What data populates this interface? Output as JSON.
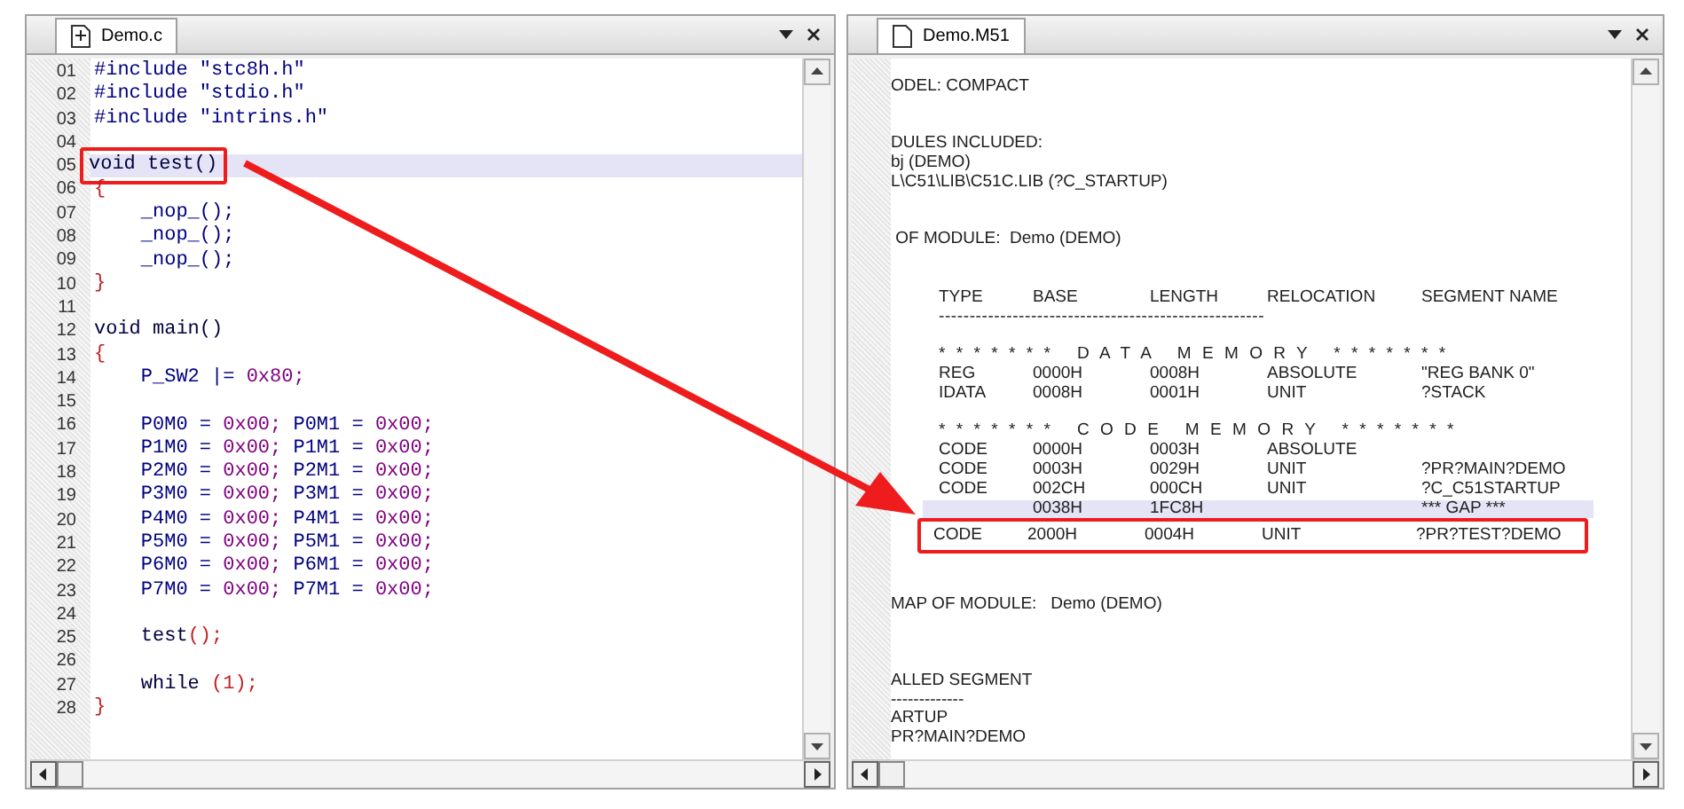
{
  "editor": {
    "tab": {
      "label": "Demo.c",
      "selected": true
    },
    "lines": [
      {
        "number": "01",
        "parts": [
          {
            "text": "#include \"stc8h.h\"",
            "color": "#000080"
          }
        ],
        "current": false,
        "boxed": false
      },
      {
        "number": "02",
        "parts": [
          {
            "text": "#include \"stdio.h\"",
            "color": "#000080"
          }
        ],
        "current": false,
        "boxed": false
      },
      {
        "number": "03",
        "parts": [
          {
            "text": "#include \"intrins.h\"",
            "color": "#000080"
          }
        ],
        "current": false,
        "boxed": false
      },
      {
        "number": "04",
        "current": false,
        "boxed": false
      },
      {
        "number": "05",
        "parts": [
          {
            "text": "void test()",
            "color": "#000040"
          }
        ],
        "current": true,
        "boxed": true
      },
      {
        "number": "06",
        "parts": [
          {
            "text": "{",
            "color": "#c02020"
          }
        ],
        "current": false,
        "boxed": false
      },
      {
        "number": "07",
        "parts": [
          {
            "text": "    _nop_();",
            "color": "#000080"
          }
        ],
        "current": false,
        "boxed": false
      },
      {
        "number": "08",
        "parts": [
          {
            "text": "    _nop_();",
            "color": "#000080"
          }
        ],
        "current": false,
        "boxed": false
      },
      {
        "number": "09",
        "parts": [
          {
            "text": "    _nop_();",
            "color": "#000080"
          }
        ],
        "current": false,
        "boxed": false
      },
      {
        "number": "10",
        "parts": [
          {
            "text": "}",
            "color": "#c02020"
          }
        ],
        "current": false,
        "boxed": false
      },
      {
        "number": "11",
        "current": false,
        "boxed": false
      },
      {
        "number": "12",
        "parts": [
          {
            "text": "void main()",
            "color": "#000040"
          }
        ],
        "current": false,
        "boxed": false
      },
      {
        "number": "13",
        "parts": [
          {
            "text": "{",
            "color": "#c02020"
          }
        ],
        "current": false,
        "boxed": false
      },
      {
        "number": "14",
        "parts": [
          {
            "text": "    P_SW2 |= ",
            "color": "#000080"
          },
          {
            "text": "0x80;",
            "color": "#800080"
          }
        ],
        "current": false,
        "boxed": false
      },
      {
        "number": "15",
        "current": false,
        "boxed": false
      },
      {
        "number": "16",
        "parts": [
          {
            "text": "    P0M0 = ",
            "color": "#000080"
          },
          {
            "text": "0x00; ",
            "color": "#800080"
          },
          {
            "text": "P0M1 = ",
            "color": "#000080"
          },
          {
            "text": "0x00;",
            "color": "#800080"
          }
        ],
        "current": false,
        "boxed": false
      },
      {
        "number": "17",
        "parts": [
          {
            "text": "    P1M0 = ",
            "color": "#000080"
          },
          {
            "text": "0x00; ",
            "color": "#800080"
          },
          {
            "text": "P1M1 = ",
            "color": "#000080"
          },
          {
            "text": "0x00;",
            "color": "#800080"
          }
        ],
        "current": false,
        "boxed": false
      },
      {
        "number": "18",
        "parts": [
          {
            "text": "    P2M0 = ",
            "color": "#000080"
          },
          {
            "text": "0x00; ",
            "color": "#800080"
          },
          {
            "text": "P2M1 = ",
            "color": "#000080"
          },
          {
            "text": "0x00;",
            "color": "#800080"
          }
        ],
        "current": false,
        "boxed": false
      },
      {
        "number": "19",
        "parts": [
          {
            "text": "    P3M0 = ",
            "color": "#000080"
          },
          {
            "text": "0x00; ",
            "color": "#800080"
          },
          {
            "text": "P3M1 = ",
            "color": "#000080"
          },
          {
            "text": "0x00;",
            "color": "#800080"
          }
        ],
        "current": false,
        "boxed": false
      },
      {
        "number": "20",
        "parts": [
          {
            "text": "    P4M0 = ",
            "color": "#000080"
          },
          {
            "text": "0x00; ",
            "color": "#800080"
          },
          {
            "text": "P4M1 = ",
            "color": "#000080"
          },
          {
            "text": "0x00;",
            "color": "#800080"
          }
        ],
        "current": false,
        "boxed": false
      },
      {
        "number": "21",
        "parts": [
          {
            "text": "    P5M0 = ",
            "color": "#000080"
          },
          {
            "text": "0x00; ",
            "color": "#800080"
          },
          {
            "text": "P5M1 = ",
            "color": "#000080"
          },
          {
            "text": "0x00;",
            "color": "#800080"
          }
        ],
        "current": false,
        "boxed": false
      },
      {
        "number": "22",
        "parts": [
          {
            "text": "    P6M0 = ",
            "color": "#000080"
          },
          {
            "text": "0x00; ",
            "color": "#800080"
          },
          {
            "text": "P6M1 = ",
            "color": "#000080"
          },
          {
            "text": "0x00;",
            "color": "#800080"
          }
        ],
        "current": false,
        "boxed": false
      },
      {
        "number": "23",
        "parts": [
          {
            "text": "    P7M0 = ",
            "color": "#000080"
          },
          {
            "text": "0x00; ",
            "color": "#800080"
          },
          {
            "text": "P7M1 = ",
            "color": "#000080"
          },
          {
            "text": "0x00;",
            "color": "#800080"
          }
        ],
        "current": false,
        "boxed": false
      },
      {
        "number": "24",
        "current": false,
        "boxed": false
      },
      {
        "number": "25",
        "parts": [
          {
            "text": "    test",
            "color": "#000040"
          },
          {
            "text": "();",
            "color": "#c02020"
          }
        ],
        "current": false,
        "boxed": false
      },
      {
        "number": "26",
        "current": false,
        "boxed": false
      },
      {
        "number": "27",
        "parts": [
          {
            "text": "    while ",
            "color": "#000040"
          },
          {
            "text": "(1);",
            "color": "#c02020"
          }
        ],
        "current": false,
        "boxed": false
      },
      {
        "number": "28",
        "parts": [
          {
            "text": "}",
            "color": "#c02020"
          }
        ],
        "current": false,
        "boxed": false
      }
    ]
  },
  "map_file": {
    "tab": {
      "label": "Demo.M51",
      "selected": true
    },
    "lines": [
      {
        "kind": "text",
        "text": "ODEL: COMPACT"
      },
      {
        "kind": "blank"
      },
      {
        "kind": "blank"
      },
      {
        "kind": "text",
        "text": "DULES INCLUDED:"
      },
      {
        "kind": "text",
        "text": "bj (DEMO)"
      },
      {
        "kind": "text",
        "text": "L\\C51\\LIB\\C51C.LIB (?C_STARTUP)"
      },
      {
        "kind": "blank"
      },
      {
        "kind": "blank"
      },
      {
        "kind": "text",
        "text": " OF MODULE:  Demo (DEMO)"
      },
      {
        "kind": "blank"
      },
      {
        "kind": "blank"
      },
      {
        "kind": "row",
        "cells": [
          "TYPE",
          "BASE",
          "LENGTH",
          "RELOCATION",
          "SEGMENT NAME"
        ],
        "current": false,
        "boxed": false
      },
      {
        "kind": "rule",
        "text": "-----------------------------------------------------"
      },
      {
        "kind": "blank"
      },
      {
        "kind": "banner",
        "text": "*  *  *  *  *  *  *     D  A  T  A     M  E  M  O  R  Y     *  *  *  *  *  *  *"
      },
      {
        "kind": "row",
        "cells": [
          "REG",
          "0000H",
          "0008H",
          "ABSOLUTE",
          "\"REG BANK 0\""
        ],
        "current": false,
        "boxed": false
      },
      {
        "kind": "row",
        "cells": [
          "IDATA",
          "0008H",
          "0001H",
          "UNIT",
          "?STACK"
        ],
        "current": false,
        "boxed": false
      },
      {
        "kind": "blank"
      },
      {
        "kind": "banner",
        "text": "*  *  *  *  *  *  *     C  O  D  E     M  E  M  O  R  Y     *  *  *  *  *  *  *"
      },
      {
        "kind": "row",
        "cells": [
          "CODE",
          "0000H",
          "0003H",
          "ABSOLUTE",
          ""
        ],
        "current": false,
        "boxed": false
      },
      {
        "kind": "row",
        "cells": [
          "CODE",
          "0003H",
          "0029H",
          "UNIT",
          "?PR?MAIN?DEMO"
        ],
        "current": false,
        "boxed": false
      },
      {
        "kind": "row",
        "cells": [
          "CODE",
          "002CH",
          "000CH",
          "UNIT",
          "?C_C51STARTUP"
        ],
        "current": false,
        "boxed": false
      },
      {
        "kind": "row",
        "cells": [
          "",
          "0038H",
          "1FC8H",
          "",
          "*** GAP ***"
        ],
        "current": true,
        "boxed": false
      },
      {
        "kind": "row",
        "cells": [
          "CODE",
          "2000H",
          "0004H",
          "UNIT",
          "?PR?TEST?DEMO"
        ],
        "current": false,
        "boxed": true
      },
      {
        "kind": "blank"
      },
      {
        "kind": "blank"
      },
      {
        "kind": "blank"
      },
      {
        "kind": "text",
        "text": "MAP OF MODULE:   Demo (DEMO)"
      },
      {
        "kind": "blank"
      },
      {
        "kind": "blank"
      },
      {
        "kind": "blank"
      },
      {
        "kind": "text",
        "text": "ALLED SEGMENT"
      },
      {
        "kind": "text",
        "text": "-------------"
      },
      {
        "kind": "text",
        "text": "ARTUP"
      },
      {
        "kind": "text",
        "text": "PR?MAIN?DEMO"
      }
    ]
  }
}
